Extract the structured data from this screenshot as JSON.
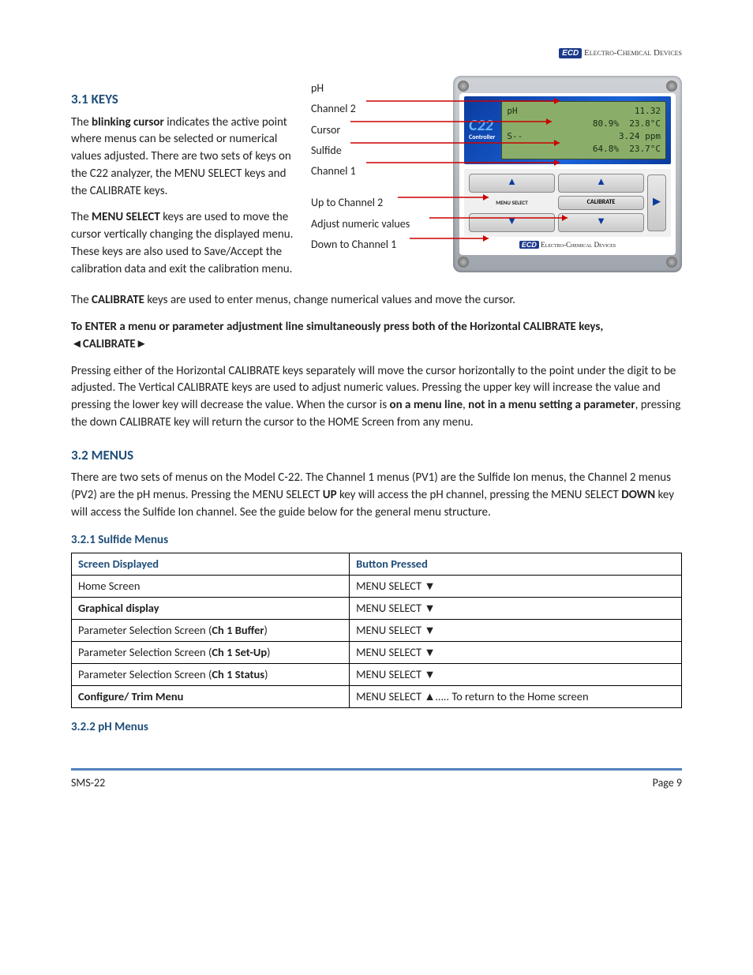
{
  "header": {
    "logo_text": "Electro-Chemical Devices",
    "logo_badge": "ECD"
  },
  "s31": {
    "heading": "3.1 KEYS",
    "p1_a": "The ",
    "p1_b": "blinking cursor",
    "p1_c": " indicates the active point where menus can be selected or numerical values adjusted. There are two sets of keys on the C22 analyzer, the MENU SELECT keys and the CALIBRATE keys.",
    "p2_a": "The ",
    "p2_b": "MENU SELECT",
    "p2_c": " keys are used to move the cursor vertically changing the displayed menu. These keys are also used to Save/Accept the calibration data and exit the calibration menu.",
    "p3_a": "The ",
    "p3_b": "CALIBRATE",
    "p3_c": " keys are used to enter menus, change numerical values and move the cursor.",
    "p4": "To ENTER a menu or parameter adjustment line simultaneously press both of the Horizontal CALIBRATE keys, ◄CALIBRATE►",
    "p5_a": "Pressing either of the Horizontal CALIBRATE keys separately will move the cursor horizontally to the point under the digit to be adjusted. The Vertical CALIBRATE keys are used to adjust numeric values. Pressing the upper key will increase the value and pressing the lower key will decrease the value. When the cursor is ",
    "p5_b": "on a menu line",
    "p5_c": ", ",
    "p5_d": "not in a menu setting a parameter",
    "p5_e": ", pressing the down CALIBRATE key will return the cursor to the HOME Screen from any menu."
  },
  "figure": {
    "labels": {
      "l1": "pH",
      "l2": "Channel 2",
      "l3": "Cursor",
      "l4": "Sulfide",
      "l5": "Channel 1",
      "l6": "Up to Channel 2",
      "l7": "Adjust numeric values",
      "l8": "Down to Channel 1"
    },
    "brand": "C22",
    "brand_sub": "Controller",
    "lcd": {
      "r1a": "pH",
      "r1b": "11.32",
      "r2a": "",
      "r2b": "80.9%  23.8°C",
      "r3a": "S--",
      "r3b": "3.24 ppm",
      "r4a": "",
      "r4b": "64.8%  23.7°C"
    },
    "key_menu": "MENU SELECT",
    "key_cal": "CALIBRATE",
    "footer_badge": "ECD",
    "footer_text": "Electro-Chemical Devices"
  },
  "s32": {
    "heading": "3.2 MENUS",
    "p1_a": "There are two sets of menus on the Model C-22. The Channel 1 menus (PV1) are the Sulfide Ion menus, the Channel 2 menus (PV2) are the pH menus. Pressing the MENU SELECT ",
    "p1_b": "UP",
    "p1_c": " key will access the pH channel, pressing the MENU SELECT ",
    "p1_d": "DOWN",
    "p1_e": " key will access the Sulfide Ion channel. See the guide below for the general menu structure."
  },
  "s321": {
    "heading": "3.2.1 Sulfide Menus",
    "th1": "Screen Displayed",
    "th2": "Button Pressed",
    "rows": [
      {
        "c1": "Home Screen",
        "c1b": "",
        "c2": "MENU SELECT ▼"
      },
      {
        "c1": "Graphical display",
        "bold1": true,
        "c2": "MENU SELECT ▼"
      },
      {
        "c1": "Parameter Selection Screen (",
        "c1b": "Ch 1 Buffer",
        "c1c": ")",
        "c2": "MENU SELECT ▼"
      },
      {
        "c1": "Parameter Selection Screen (",
        "c1b": "Ch 1 Set-Up",
        "c1c": ")",
        "c2": "MENU SELECT ▼"
      },
      {
        "c1": "Parameter Selection Screen (",
        "c1b": "Ch 1 Status",
        "c1c": ")",
        "c2": "MENU SELECT ▼"
      },
      {
        "c1": "Configure/ Trim Menu",
        "bold1": true,
        "c2": "MENU SELECT ▲….. To return to the Home screen"
      }
    ]
  },
  "s322": {
    "heading": "3.2.2 pH Menus"
  },
  "footer": {
    "left": "SMS-22",
    "right": "Page 9"
  }
}
